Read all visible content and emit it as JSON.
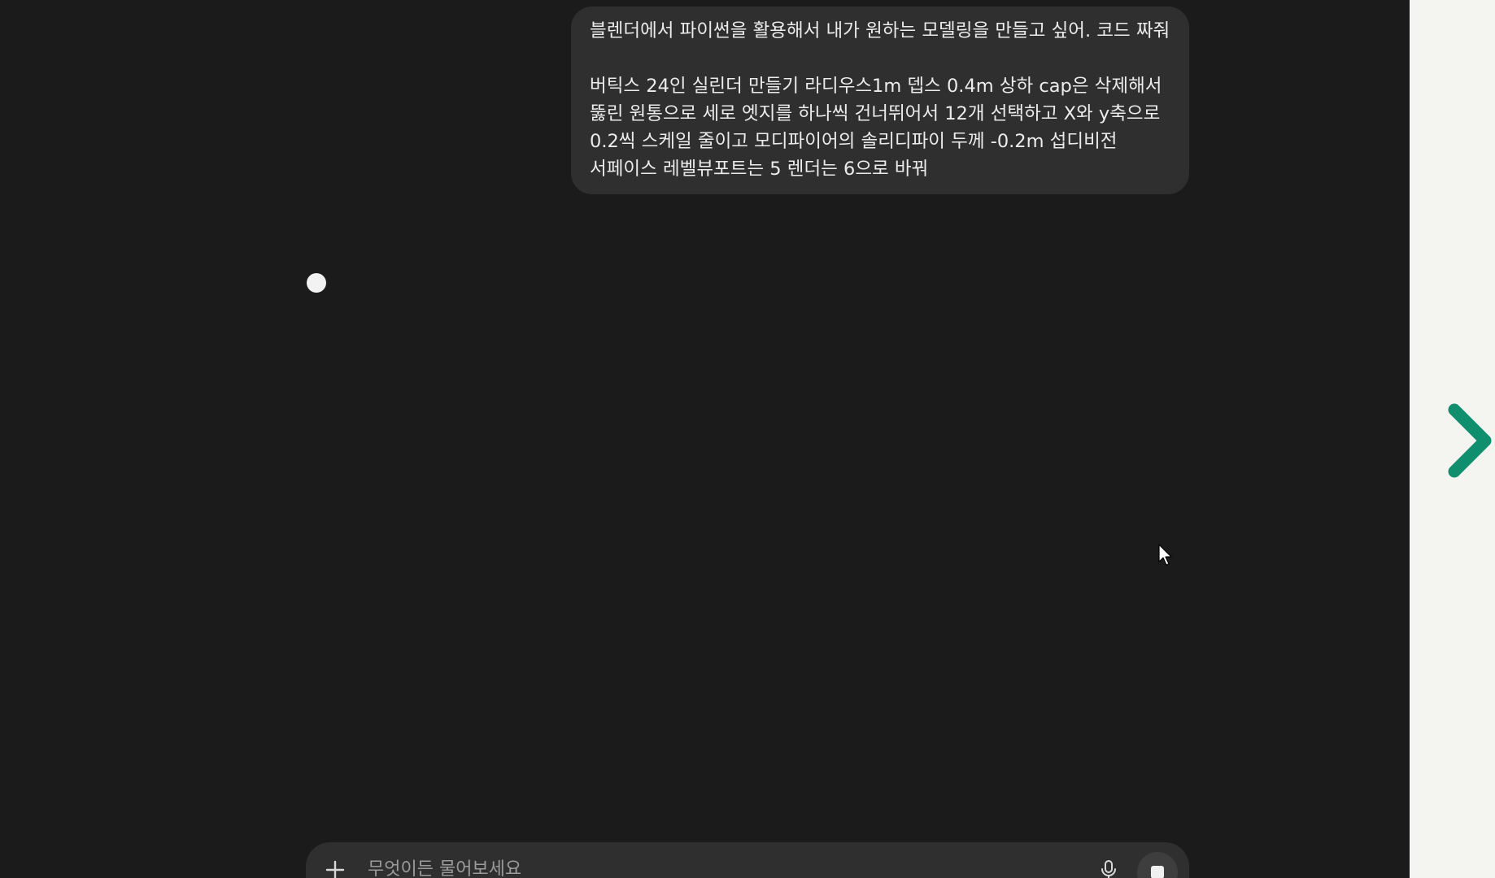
{
  "conversation": {
    "user_message": "블렌더에서 파이썬을 활용해서 내가 원하는 모델링을 만들고 싶어. 코드 짜줘\n\n버틱스 24인 실린더 만들기 라디우스1m 뎁스 0.4m 상하 cap은 삭제해서 뚫린 원통으로 세로 엣지를 하나씩 건너뛰어서 12개 선택하고 X와 y축으로 0.2씩 스케일 줄이고 모디파이어의 솔리디파이 두께 -0.2m 섭디비전 서페이스 레벨뷰포트는 5 렌더는 6으로 바꿔"
  },
  "composer": {
    "placeholder": "무엇이든 물어보세요"
  },
  "icons": {
    "plus": "plus-icon",
    "mic": "microphone-icon",
    "stop": "stop-icon",
    "next": "chevron-right-icon",
    "cursor": "mouse-pointer-icon",
    "loading": "loading-dot-icon"
  },
  "colors": {
    "background": "#1b1b1b",
    "bubble": "#2f2f2f",
    "text": "#ececec",
    "placeholder": "#9b9b9b",
    "side_panel": "#f4f4f1",
    "accent_chevron": "#0f8f6e"
  }
}
